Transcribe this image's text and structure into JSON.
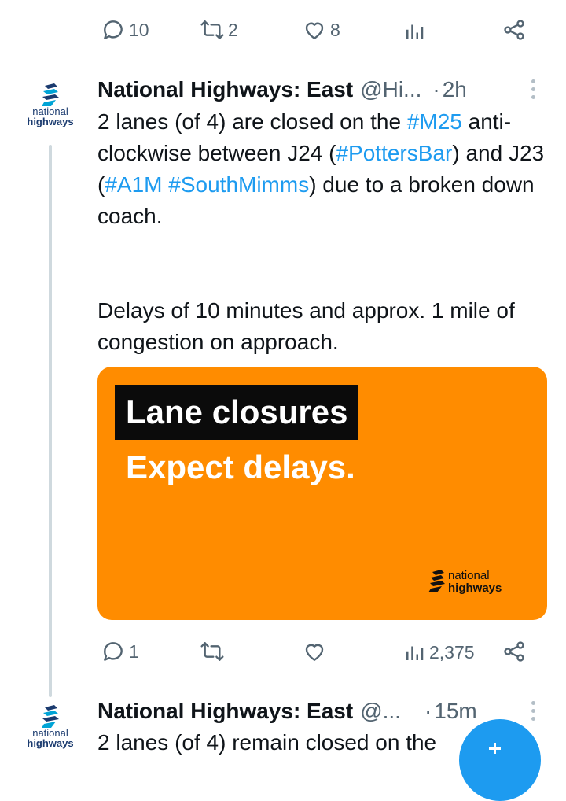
{
  "prev_tweet_actions": {
    "replies": "10",
    "retweets": "2",
    "likes": "8",
    "views": ""
  },
  "tweet1": {
    "avatar": {
      "line1": "national",
      "line2": "highways"
    },
    "name": "National Highways: East",
    "handle": "@Hi...",
    "dot": "·",
    "time": "2h",
    "text_parts": [
      "2 lanes (of 4) are closed on the ",
      "#M25",
      " anti-clockwise between J24 (",
      "#PottersBar",
      ") and J23 (",
      "#A1M",
      " ",
      "#SouthMimms",
      ") due to a broken down coach."
    ],
    "text_para2": "Delays of 10 minutes and approx. 1 mile of congestion on approach.",
    "card": {
      "headline": "Lane closures",
      "subline": "Expect delays.",
      "brand_line1": "national",
      "brand_line2": "highways"
    },
    "actions": {
      "replies": "1",
      "retweets": "",
      "likes": "",
      "views": "2,375"
    }
  },
  "tweet2": {
    "avatar": {
      "line1": "national",
      "line2": "highways"
    },
    "name": "National Highways: East",
    "handle": "@...",
    "dot": "·",
    "time": "15m",
    "text": "2 lanes (of 4) remain closed on the"
  },
  "colors": {
    "accent": "#1d9bf0",
    "card_bg": "#ff8c00",
    "muted": "#536471"
  }
}
